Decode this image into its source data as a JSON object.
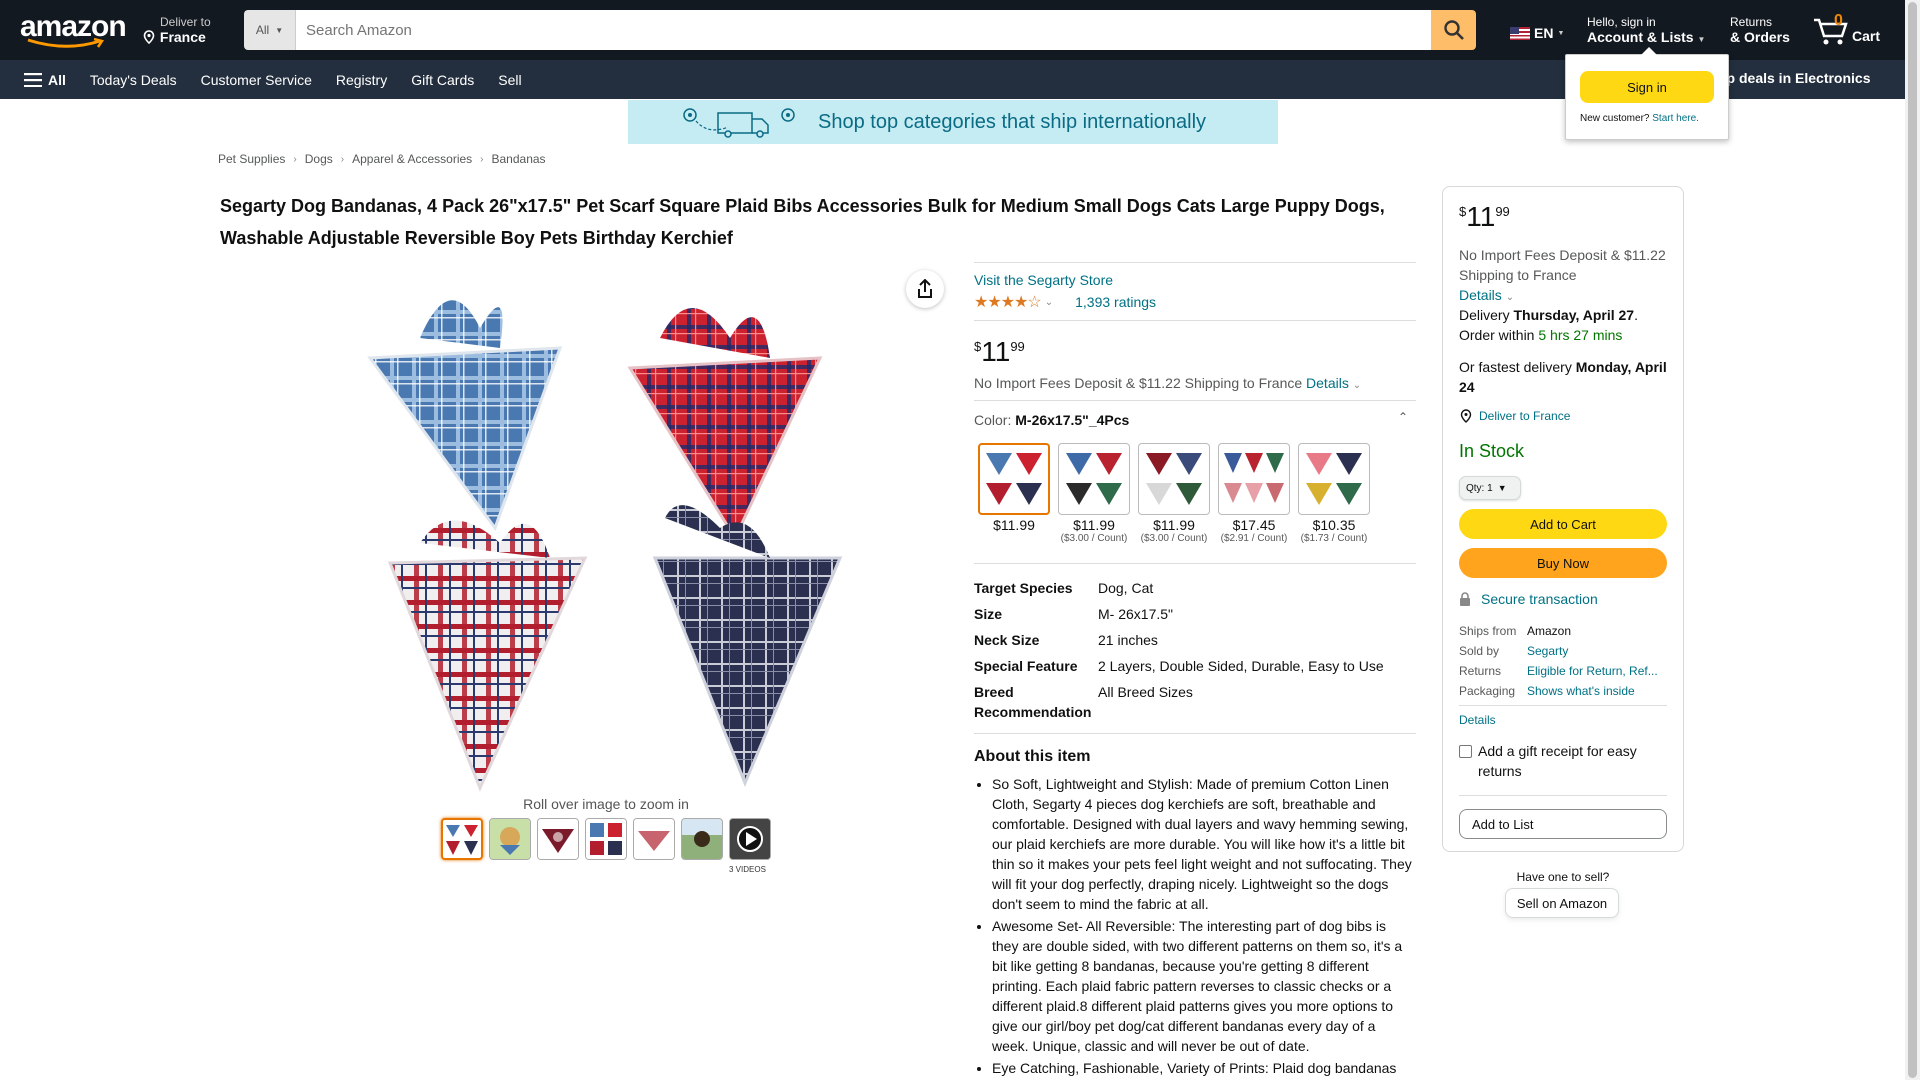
{
  "nav": {
    "logo": "amazon",
    "deliver_line1": "Deliver to",
    "deliver_line2": "France",
    "search_category": "All",
    "search_placeholder": "Search Amazon",
    "lang": "EN",
    "account_line1": "Hello, sign in",
    "account_line2": "Account & Lists",
    "returns_line1": "Returns",
    "returns_line2": "& Orders",
    "cart_count": "0",
    "cart_label": "Cart"
  },
  "subnav": {
    "all": "All",
    "links": [
      "Today's Deals",
      "Customer Service",
      "Registry",
      "Gift Cards",
      "Sell"
    ],
    "promo": "op deals in Electronics"
  },
  "flyout": {
    "signin": "Sign in",
    "new_customer": "New customer?",
    "start_here": "Start here."
  },
  "banner": "Shop top categories that ship internationally",
  "breadcrumb": [
    "Pet Supplies",
    "Dogs",
    "Apparel & Accessories",
    "Bandanas"
  ],
  "product": {
    "title": "Segarty Dog Bandanas, 4 Pack 26\"x17.5\" Pet Scarf Square Plaid Bibs Accessories Bulk for Medium Small Dogs Cats Large Puppy Dogs, Washable Adjustable Reversible Boy Pets Birthday Kerchief",
    "store": "Visit the Segarty Store",
    "stars": "★★★★☆",
    "ratings": "1,393 ratings",
    "price_symbol": "$",
    "price_whole": "11",
    "price_fraction": "99",
    "fees_text": "No Import Fees Deposit & $11.22 Shipping to France",
    "details": "Details",
    "color_label": "Color:",
    "color_value": "M-26x17.5\"_4Pcs",
    "zoom_hint": "Roll over image to zoom in",
    "videos_label": "3 VIDEOS"
  },
  "swatches": [
    {
      "price": "$11.99",
      "unit": ""
    },
    {
      "price": "$11.99",
      "unit": "($3.00 / Count)"
    },
    {
      "price": "$11.99",
      "unit": "($3.00 / Count)"
    },
    {
      "price": "$17.45",
      "unit": "($2.91 / Count)"
    },
    {
      "price": "$10.35",
      "unit": "($1.73 / Count)"
    }
  ],
  "specs": [
    {
      "k": "Target Species",
      "v": "Dog, Cat"
    },
    {
      "k": "Size",
      "v": "M- 26x17.5\""
    },
    {
      "k": "Neck Size",
      "v": "21 inches"
    },
    {
      "k": "Special Feature",
      "v": "2 Layers, Double Sided, Durable, Easy to Use"
    },
    {
      "k": "Breed Recommendation",
      "v": "All Breed Sizes"
    }
  ],
  "about": {
    "title": "About this item",
    "bullets": [
      "So Soft, Lightweight and Stylish: Made of premium Cotton Linen Cloth, Segarty 4 pieces dog kerchiefs are soft, breathable and comfortable. Designed with dual layers and wavy hemming sewing, our plaid kerchiefs are more durable. You will like how it's a little bit thin so it makes your pets feel light weight and not suffocating. They will fit your dog perfectly, draping nicely. Lightweight so the dogs don't seem to mind the fabric at all.",
      "Awesome Set- All Reversible: The interesting part of dog bibs is they are double sided, with two different patterns on them so, it's a bit like getting 8 bandanas, because you're getting 8 different printing. Each plaid fabric pattern reverses to classic checks or a different plaid.8 different plaid patterns gives you more options to give our girl/boy pet dog/cat different bandanas every day of a week. Unique, classic and will never be out of date.",
      "Eye Catching, Fashionable, Variety of Prints: Plaid dog bandanas"
    ]
  },
  "buybox": {
    "price_symbol": "$",
    "price_whole": "11",
    "price_fraction": "99",
    "fees": "No Import Fees Deposit & $11.22 Shipping to France",
    "details": "Details",
    "delivery_pre": "Delivery ",
    "delivery_date": "Thursday, April 27",
    "order_within": "Order within ",
    "countdown": "5 hrs 27 mins",
    "fastest_pre": "Or fastest delivery ",
    "fastest_date": "Monday, April 24",
    "deliver_to": "Deliver to France",
    "stock": "In Stock",
    "qty": "Qty: 1",
    "add_to_cart": "Add to Cart",
    "buy_now": "Buy Now",
    "secure": "Secure transaction",
    "ships_from_k": "Ships from",
    "ships_from_v": "Amazon",
    "sold_by_k": "Sold by",
    "sold_by_v": "Segarty",
    "returns_k": "Returns",
    "returns_v": "Eligible for Return, Ref...",
    "packaging_k": "Packaging",
    "packaging_v": "Shows what's inside",
    "details2": "Details",
    "gift": "Add a gift receipt for easy returns",
    "add_to_list": "Add to List",
    "have_one": "Have one to sell?",
    "sell_on": "Sell on Amazon"
  }
}
